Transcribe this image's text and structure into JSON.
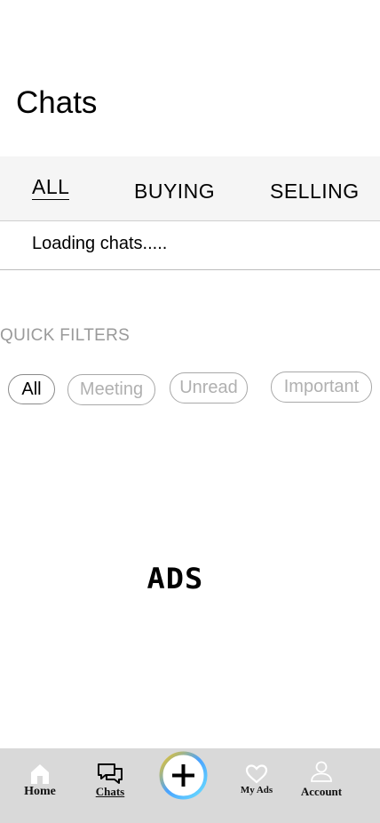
{
  "header": {
    "title": "Chats"
  },
  "tabs": [
    {
      "label": "ALL",
      "active": true
    },
    {
      "label": "BUYING",
      "active": false
    },
    {
      "label": "SELLING",
      "active": false
    }
  ],
  "status": {
    "loading_text": "Loading chats....."
  },
  "quick_filters": {
    "label": "QUICK FILTERS",
    "chips": [
      "All",
      "Meeting",
      "Unread",
      "Important"
    ],
    "selected": "All"
  },
  "ads": {
    "text": "ADS"
  },
  "bottom_nav": {
    "items": [
      {
        "label": "Home",
        "icon": "home-icon"
      },
      {
        "label": "Chats",
        "icon": "chat-icon",
        "active": true
      },
      {
        "label": "",
        "icon": "plus-icon"
      },
      {
        "label": "My Ads",
        "icon": "heart-icon"
      },
      {
        "label": "Account",
        "icon": "user-icon"
      }
    ]
  },
  "colors": {
    "tabbar_bg": "#f5f5f5",
    "navbar_bg": "#d9d9d9",
    "chip_border": "#a8a8a8",
    "muted_text": "#9a9a9a",
    "plus_ring_gradient": [
      "#f5c518",
      "#4aa3ff",
      "#6be0ff"
    ]
  }
}
